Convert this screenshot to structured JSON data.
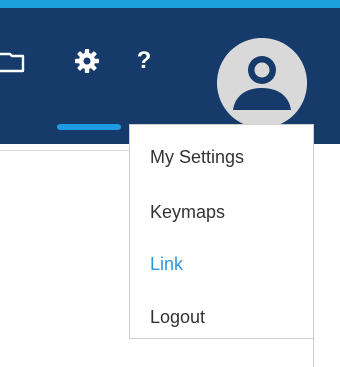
{
  "header": {
    "colors": {
      "top_border": "#1da1dc",
      "background": "#163a69",
      "active_indicator": "#1e9be3"
    },
    "icons": {
      "folder": "folder-icon",
      "settings": "gear-icon",
      "help": "help-icon",
      "profile": "avatar-icon"
    },
    "help_label": "?"
  },
  "menu": {
    "items": [
      {
        "label": "My Settings",
        "color": "#333333"
      },
      {
        "label": "Keymaps",
        "color": "#333333"
      },
      {
        "label": "Link",
        "color": "#2b96e1"
      },
      {
        "label": "Logout",
        "color": "#333333"
      }
    ]
  }
}
